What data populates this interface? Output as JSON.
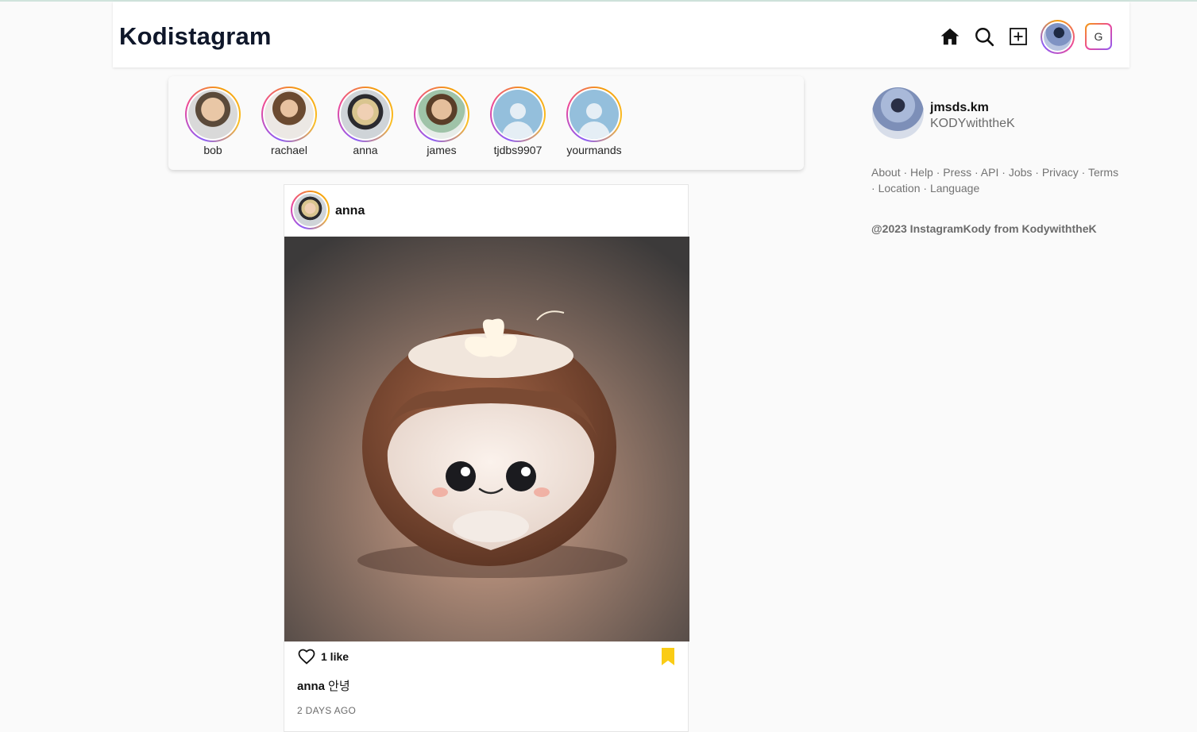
{
  "header": {
    "logo": "Kodistagram",
    "nav_icons": [
      "home-icon",
      "search-icon",
      "add-post-icon",
      "profile-avatar",
      "g-icon"
    ],
    "g_label": "G"
  },
  "stories": [
    {
      "name": "bob"
    },
    {
      "name": "rachael"
    },
    {
      "name": "anna"
    },
    {
      "name": "james"
    },
    {
      "name": "tjdbs9907"
    },
    {
      "name": "yourmands"
    }
  ],
  "post": {
    "username": "anna",
    "likes": "1 like",
    "caption_user": "anna",
    "caption_text": "안녕",
    "time": "2 DAYS AGO"
  },
  "profile": {
    "username": "jmsds.km",
    "fullname": "KODYwiththeK"
  },
  "footer": {
    "links": [
      "About",
      "Help",
      "Press",
      "API",
      "Jobs",
      "Privacy",
      "Terms",
      "Location",
      "Language"
    ],
    "separator": "·",
    "copyright": "@2023 InstagramKody from KodywiththeK"
  },
  "colors": {
    "accent_bookmark": "#facc15",
    "ring_gradient": [
      "#f59e0b",
      "#ec4899",
      "#8b5cf6"
    ],
    "logo": "#0f172a"
  }
}
